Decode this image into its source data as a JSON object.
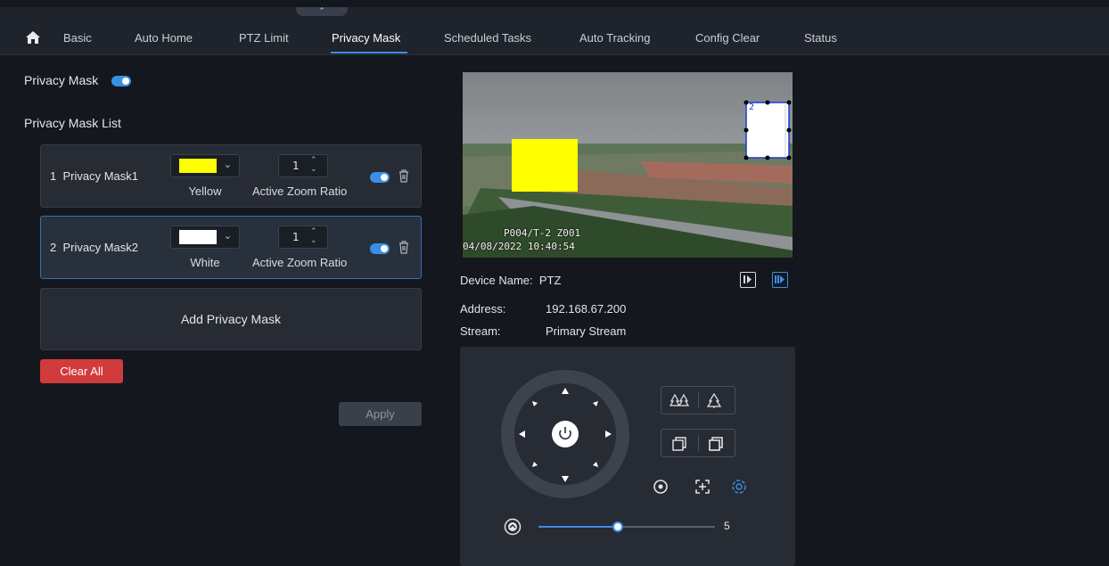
{
  "nav": {
    "tabs": [
      {
        "label": "Basic"
      },
      {
        "label": "Auto Home"
      },
      {
        "label": "PTZ Limit"
      },
      {
        "label": "Privacy Mask",
        "active": true
      },
      {
        "label": "Scheduled Tasks"
      },
      {
        "label": "Auto Tracking"
      },
      {
        "label": "Config Clear"
      },
      {
        "label": "Status"
      }
    ],
    "home_icon": "home-icon",
    "collapse_icon": "chevron-up-icon"
  },
  "privacy_mask": {
    "label": "Privacy Mask",
    "enabled": true,
    "list_title": "Privacy Mask List",
    "masks": [
      {
        "index": "1",
        "name": "Privacy Mask1",
        "color_name": "Yellow",
        "color": "#ffff00",
        "zoom_ratio": "1",
        "zoom_label": "Active Zoom Ratio",
        "enabled": true
      },
      {
        "index": "2",
        "name": "Privacy Mask2",
        "color_name": "White",
        "color": "#ffffff",
        "zoom_ratio": "1",
        "zoom_label": "Active Zoom Ratio",
        "enabled": true
      }
    ],
    "add_label": "Add Privacy Mask",
    "clear_all_label": "Clear All",
    "apply_label": "Apply"
  },
  "video": {
    "osd_camera": "P004/T-2   Z001",
    "osd_time": "04/08/2022 10:40:54",
    "mask_region_label": "2"
  },
  "device": {
    "name_label": "Device Name:",
    "name_value": "PTZ",
    "address_label": "Address:",
    "address_value": "192.168.67.200",
    "stream_label": "Stream:",
    "stream_value": "Primary Stream"
  },
  "ptz": {
    "speed_value": "5",
    "speed_fraction": 0.45
  },
  "colors": {
    "accent": "#3a8ee6",
    "danger": "#d23b3b",
    "background": "#14171d",
    "panel": "#262b34"
  }
}
